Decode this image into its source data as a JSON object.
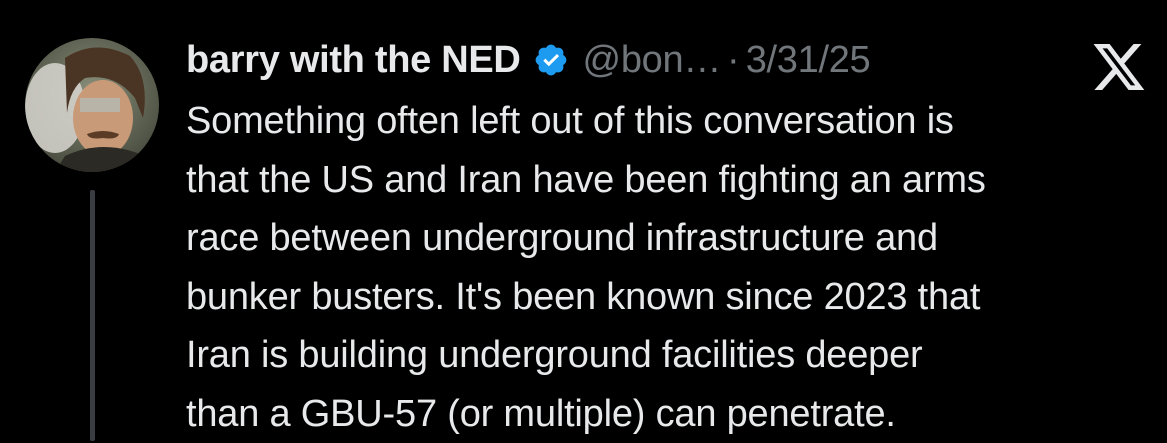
{
  "tweet": {
    "author": {
      "display_name": "barry with the NED",
      "handle": "@bon…",
      "avatar_icon": "avatar-photo"
    },
    "separator": "·",
    "date": "3/31/25",
    "verified_icon": "verified-badge-icon",
    "brand_icon": "x-logo-icon",
    "text_lines": [
      "Something often left out of this conversation is",
      "that the US and Iran have been fighting an arms",
      "race between underground infrastructure and",
      "bunker busters. It's been known since 2023 that",
      "Iran is building underground facilities deeper",
      "than a GBU-57 (or multiple) can penetrate."
    ]
  },
  "colors": {
    "background": "#000000",
    "primary_text": "#e7e9ea",
    "secondary_text": "#71767b",
    "verified_blue": "#1d9bf0",
    "thread_line": "#3a3d41"
  }
}
